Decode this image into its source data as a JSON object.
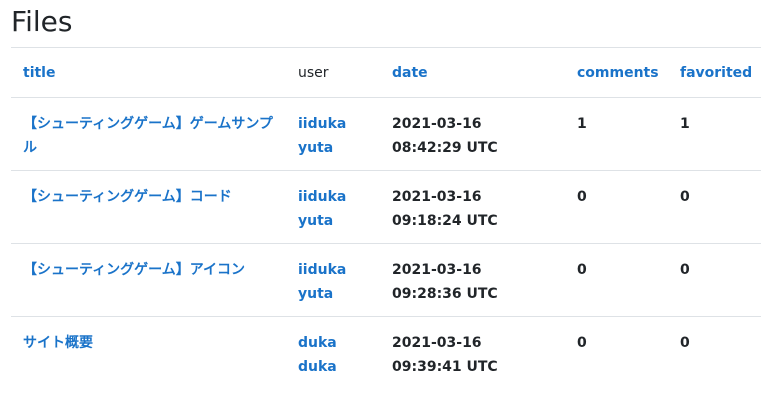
{
  "page": {
    "heading": "Files"
  },
  "table": {
    "headers": {
      "title": "title",
      "user": "user",
      "date": "date",
      "comments": "comments",
      "favorited": "favorited"
    },
    "rows": [
      {
        "title": "【シューティングゲーム】ゲームサンプル",
        "user": "iiduka yuta",
        "date": "2021-03-16 08:42:29 UTC",
        "comments": "1",
        "favorited": "1"
      },
      {
        "title": "【シューティングゲーム】コード",
        "user": "iiduka yuta",
        "date": "2021-03-16 09:18:24 UTC",
        "comments": "0",
        "favorited": "0"
      },
      {
        "title": "【シューティングゲーム】アイコン",
        "user": "iiduka yuta",
        "date": "2021-03-16 09:28:36 UTC",
        "comments": "0",
        "favorited": "0"
      },
      {
        "title": "サイト概要",
        "user": "duka duka",
        "date": "2021-03-16 09:39:41 UTC",
        "comments": "0",
        "favorited": "0"
      }
    ]
  },
  "colors": {
    "link": "#1a73c9",
    "text": "#212529",
    "border": "#dee2e6"
  }
}
